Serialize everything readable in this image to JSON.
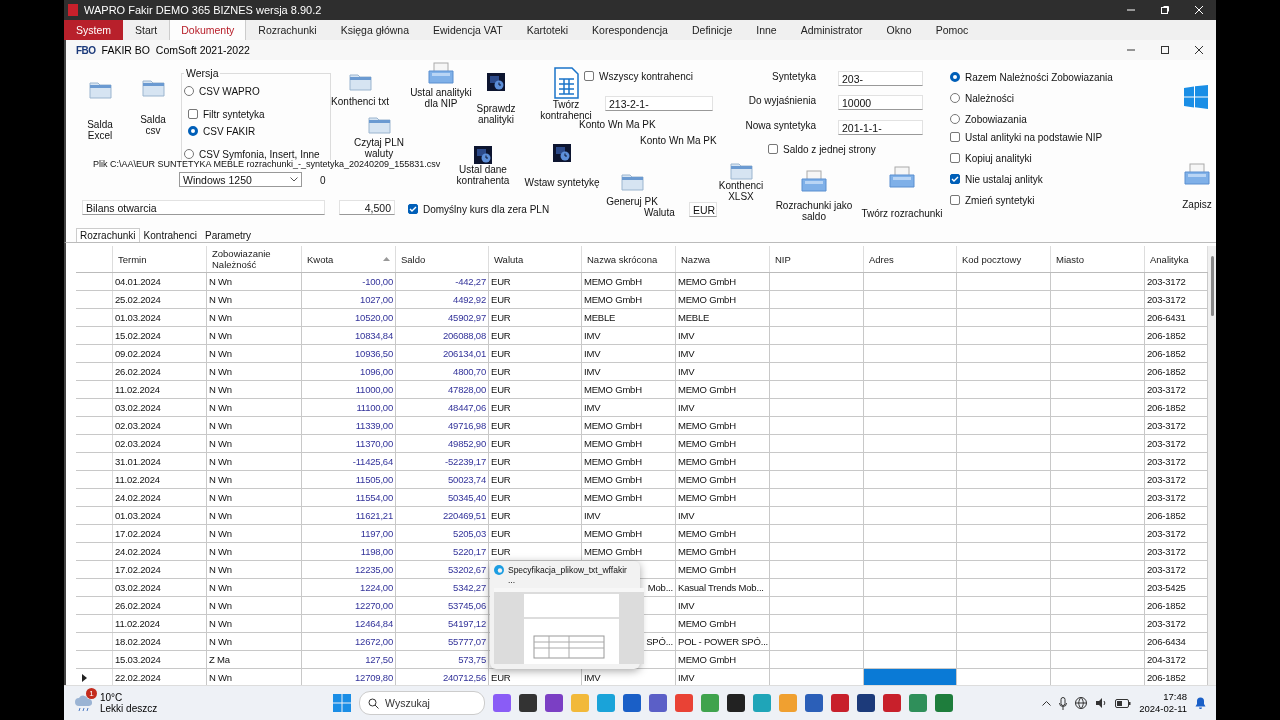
{
  "app_title": "WAPRO Fakir DEMO 365 BIZNES wersja 8.90.2",
  "menu": [
    {
      "label": "System",
      "kind": "system",
      "selected": false
    },
    {
      "label": "Start",
      "kind": "item",
      "selected": false
    },
    {
      "label": "Dokumenty",
      "kind": "item",
      "selected": true
    },
    {
      "label": "Rozrachunki",
      "kind": "item",
      "selected": false
    },
    {
      "label": "Księga główna",
      "kind": "item",
      "selected": false
    },
    {
      "label": "Ewidencja VAT",
      "kind": "item",
      "selected": false
    },
    {
      "label": "Kartoteki",
      "kind": "item",
      "selected": false
    },
    {
      "label": "Korespondencja",
      "kind": "item",
      "selected": false
    },
    {
      "label": "Definicje",
      "kind": "item",
      "selected": false
    },
    {
      "label": "Inne",
      "kind": "item",
      "selected": false
    },
    {
      "label": "Administrator",
      "kind": "item",
      "selected": false
    },
    {
      "label": "Okno",
      "kind": "item",
      "selected": false
    },
    {
      "label": "Pomoc",
      "kind": "item",
      "selected": false
    }
  ],
  "child_window": {
    "logo": "FBO",
    "title": "FAKIR BO  ComSoft 2021-2022"
  },
  "form": {
    "buttons": [
      {
        "label": "Salda Excel",
        "kind": "folder"
      },
      {
        "label": "Salda csv",
        "kind": "folder"
      },
      {
        "label": "Konthenci txt",
        "kind": "folder"
      },
      {
        "label": "Czytaj PLN waluty",
        "kind": "folder"
      },
      {
        "label": "Ustal analityki dla NIP",
        "kind": "printer"
      },
      {
        "label": "Sprawdz analityki",
        "kind": "calendar"
      },
      {
        "label": "Twórz kontrahenci",
        "kind": "sheet"
      },
      {
        "label": "Ustal dane kontrahenta",
        "kind": "calendar"
      },
      {
        "label": "Wstaw syntetykę",
        "kind": "calendar"
      },
      {
        "label": "Generuj PK",
        "kind": "folder"
      },
      {
        "label": "Konthenci XLSX",
        "kind": "folder"
      },
      {
        "label": "Rozrachunki jako saldo",
        "kind": "printer"
      },
      {
        "label": "Twórz rozrachunki",
        "kind": "printer"
      },
      {
        "label": "Zapisz",
        "kind": "printer"
      }
    ],
    "version_group": {
      "title": "Wersja",
      "options": [
        {
          "kind": "radio",
          "label": "CSV WAPRO",
          "selected": false
        },
        {
          "kind": "checkbox",
          "label": "Filtr syntetyka",
          "checked": false
        },
        {
          "kind": "radio",
          "label": "CSV FAKIR",
          "selected": true
        },
        {
          "kind": "radio",
          "label": "CSV Symfonia, Insert, Inne",
          "selected": false
        }
      ]
    },
    "file_path": "Plik C:\\AA\\EUR SUNTETYKA MEBLE  rozrachunki_-_syntetyka_20240209_155831.csv",
    "encoding": "Windows 1250",
    "counter": "0",
    "document_type": "Bilans otwarcia",
    "rate": "4,500",
    "default_rate": {
      "label": "Domyślny kurs dla zera PLN",
      "checked": true
    },
    "all_contractors": {
      "label": "Wszyscy kontrahenci",
      "checked": false
    },
    "account_field": "213-2-1-",
    "account_labels": [
      "Konto Wn Ma PK",
      "Konto Wn Ma PK"
    ],
    "currency": {
      "label": "Waluta",
      "value": "EUR"
    },
    "fields": [
      {
        "label": "Syntetyka",
        "value": "203-"
      },
      {
        "label": "Do wyjaśnienia",
        "value": "10000"
      },
      {
        "label": "Nowa syntetyka",
        "value": "201-1-1-"
      }
    ],
    "one_side": {
      "label": "Saldo z jednej strony",
      "checked": false
    },
    "options": [
      {
        "kind": "radio",
        "label": "Razem Należności Zobowiazania",
        "selected": true
      },
      {
        "kind": "radio",
        "label": "Należności",
        "selected": false
      },
      {
        "kind": "radio",
        "label": "Zobowiazania",
        "selected": false
      },
      {
        "kind": "checkbox",
        "label": "Ustal anlityki na podstawie NIP",
        "checked": false
      },
      {
        "kind": "checkbox",
        "label": "Kopiuj analityki",
        "checked": false
      },
      {
        "kind": "checkbox",
        "label": "Nie ustalaj anlityk",
        "checked": true
      },
      {
        "kind": "checkbox",
        "label": "Zmień syntetyki",
        "checked": false
      }
    ]
  },
  "tabs": [
    {
      "label": "Rozrachunki",
      "selected": true
    },
    {
      "label": "Kontrahenci",
      "selected": false
    },
    {
      "label": "Parametry",
      "selected": false
    }
  ],
  "table": {
    "columns": [
      {
        "label": "Termin"
      },
      {
        "label": "Zobowiazanie Należność"
      },
      {
        "label": "Kwota",
        "sorted": true
      },
      {
        "label": "Saldo"
      },
      {
        "label": "Waluta"
      },
      {
        "label": "Nazwa skrócona"
      },
      {
        "label": "Nazwa"
      },
      {
        "label": "NIP"
      },
      {
        "label": "Adres"
      },
      {
        "label": "Kod pocztowy"
      },
      {
        "label": "Miasto"
      },
      {
        "label": "Analityka"
      }
    ],
    "rows": [
      {
        "selected": false,
        "date": "04.01.2024",
        "type": "N Wn",
        "amount": "-100,00",
        "balance": "-442,27",
        "currency": "EUR",
        "short_name": "MEMO GmbH",
        "name": "MEMO GmbH",
        "analytic": "203-3172"
      },
      {
        "selected": false,
        "date": "25.02.2024",
        "type": "N Wn",
        "amount": "1027,00",
        "balance": "4492,92",
        "currency": "EUR",
        "short_name": "MEMO GmbH",
        "name": "MEMO GmbH",
        "analytic": "203-3172"
      },
      {
        "selected": false,
        "date": "01.03.2024",
        "type": "N Wn",
        "amount": "10520,00",
        "balance": "45902,97",
        "currency": "EUR",
        "short_name": "MEBLE",
        "name": "MEBLE",
        "analytic": "206-6431"
      },
      {
        "selected": false,
        "date": "15.02.2024",
        "type": "N Wn",
        "amount": "10834,84",
        "balance": "206088,08",
        "currency": "EUR",
        "short_name": "IMV",
        "name": "IMV",
        "analytic": "206-1852"
      },
      {
        "selected": false,
        "date": "09.02.2024",
        "type": "N Wn",
        "amount": "10936,50",
        "balance": "206134,01",
        "currency": "EUR",
        "short_name": "IMV",
        "name": "IMV",
        "analytic": "206-1852"
      },
      {
        "selected": false,
        "date": "26.02.2024",
        "type": "N Wn",
        "amount": "1096,00",
        "balance": "4800,70",
        "currency": "EUR",
        "short_name": "IMV",
        "name": "IMV",
        "analytic": "206-1852"
      },
      {
        "selected": false,
        "date": "11.02.2024",
        "type": "N Wn",
        "amount": "11000,00",
        "balance": "47828,00",
        "currency": "EUR",
        "short_name": "MEMO GmbH",
        "name": "MEMO GmbH",
        "analytic": "203-3172"
      },
      {
        "selected": false,
        "date": "03.02.2024",
        "type": "N Wn",
        "amount": "11100,00",
        "balance": "48447,06",
        "currency": "EUR",
        "short_name": "IMV",
        "name": "IMV",
        "analytic": "206-1852"
      },
      {
        "selected": false,
        "date": "02.03.2024",
        "type": "N Wn",
        "amount": "11339,00",
        "balance": "49716,98",
        "currency": "EUR",
        "short_name": "MEMO GmbH",
        "name": "MEMO GmbH",
        "analytic": "203-3172"
      },
      {
        "selected": false,
        "date": "02.03.2024",
        "type": "N Wn",
        "amount": "11370,00",
        "balance": "49852,90",
        "currency": "EUR",
        "short_name": "MEMO GmbH",
        "name": "MEMO GmbH",
        "analytic": "203-3172"
      },
      {
        "selected": false,
        "date": "31.01.2024",
        "type": "N Wn",
        "amount": "-11425,64",
        "balance": "-52239,17",
        "currency": "EUR",
        "short_name": "MEMO GmbH",
        "name": "MEMO GmbH",
        "analytic": "203-3172"
      },
      {
        "selected": false,
        "date": "11.02.2024",
        "type": "N Wn",
        "amount": "11505,00",
        "balance": "50023,74",
        "currency": "EUR",
        "short_name": "MEMO GmbH",
        "name": "MEMO GmbH",
        "analytic": "203-3172"
      },
      {
        "selected": false,
        "date": "24.02.2024",
        "type": "N Wn",
        "amount": "11554,00",
        "balance": "50345,40",
        "currency": "EUR",
        "short_name": "MEMO GmbH",
        "name": "MEMO GmbH",
        "analytic": "203-3172"
      },
      {
        "selected": false,
        "date": "01.03.2024",
        "type": "N Wn",
        "amount": "11621,21",
        "balance": "220469,51",
        "currency": "EUR",
        "short_name": "IMV",
        "name": "IMV",
        "analytic": "206-1852"
      },
      {
        "selected": false,
        "date": "17.02.2024",
        "type": "N Wn",
        "amount": "1197,00",
        "balance": "5205,03",
        "currency": "EUR",
        "short_name": "MEMO GmbH",
        "name": "MEMO GmbH",
        "analytic": "203-3172"
      },
      {
        "selected": false,
        "date": "24.02.2024",
        "type": "N Wn",
        "amount": "1198,00",
        "balance": "5220,17",
        "currency": "EUR",
        "short_name": "MEMO GmbH",
        "name": "MEMO GmbH",
        "analytic": "203-3172"
      },
      {
        "selected": false,
        "date": "17.02.2024",
        "type": "N Wn",
        "amount": "12235,00",
        "balance": "53202,67",
        "name": "MEMO GmbH",
        "analytic": "203-3172"
      },
      {
        "selected": false,
        "date": "03.02.2024",
        "type": "N Wn",
        "amount": "1224,00",
        "balance": "5342,27",
        "short_name": "Mob...",
        "name": "Kasual Trends Mob...",
        "analytic": "203-5425"
      },
      {
        "selected": false,
        "date": "26.02.2024",
        "type": "N Wn",
        "amount": "12270,00",
        "balance": "53745,06",
        "name": "IMV",
        "analytic": "206-1852"
      },
      {
        "selected": false,
        "date": "11.02.2024",
        "type": "N Wn",
        "amount": "12464,84",
        "balance": "54197,12",
        "name": "MEMO GmbH",
        "analytic": "203-3172"
      },
      {
        "selected": false,
        "date": "18.02.2024",
        "type": "N Wn",
        "amount": "12672,00",
        "balance": "55777,07",
        "short_name": "SPÓ...",
        "name": "POL - POWER SPÓ...",
        "analytic": "206-6434"
      },
      {
        "selected": false,
        "date": "15.03.2024",
        "type": "Z Ma",
        "amount": "127,50",
        "balance": "573,75",
        "name": "MEMO GmbH",
        "analytic": "204-3172"
      },
      {
        "selected": true,
        "date": "22.02.2024",
        "type": "N Wn",
        "amount": "12709,80",
        "balance": "240712,56",
        "currency": "EUR",
        "short_name": "IMV",
        "name": "IMV",
        "analytic": "206-1852"
      }
    ]
  },
  "preview": {
    "title": "Specyfikacja_plikow_txt_wffakir ..."
  },
  "taskbar": {
    "weather_badge": "1",
    "temperature": "10°C",
    "weather": "Lekki deszcz",
    "search": {
      "placeholder": "Wyszukaj"
    },
    "time": "17:48",
    "date": "2024-02-11"
  }
}
